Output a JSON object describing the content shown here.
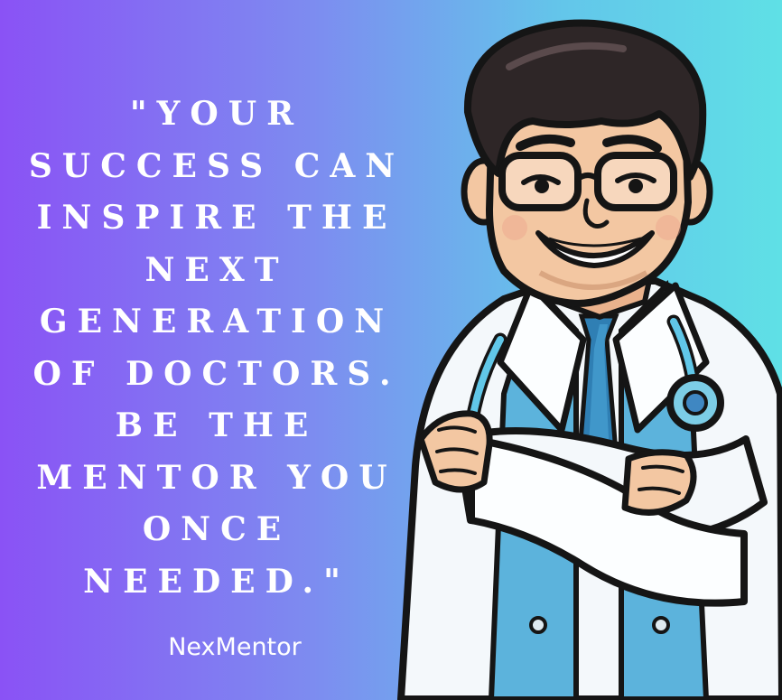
{
  "quote": {
    "lines": [
      "\"YOUR",
      "SUCCESS CAN",
      "INSPIRE THE",
      "NEXT",
      "GENERATION",
      "OF DOCTORS.",
      "BE THE",
      "MENTOR YOU",
      "ONCE",
      "NEEDED.\""
    ]
  },
  "brand": {
    "name": "NexMentor"
  },
  "illustration": {
    "icon": "doctor-illustration",
    "subject": "cartoon-doctor-with-stethoscope"
  },
  "colors": {
    "background_left": "#8a52f5",
    "background_right": "#5fe0e6",
    "text": "#ffffff",
    "coat": "#f4f8fb",
    "shirt": "#5cb3dc",
    "tie": "#2f7fb4",
    "hair": "#2e2627",
    "skin": "#f3c7a2",
    "outline": "#151515"
  }
}
